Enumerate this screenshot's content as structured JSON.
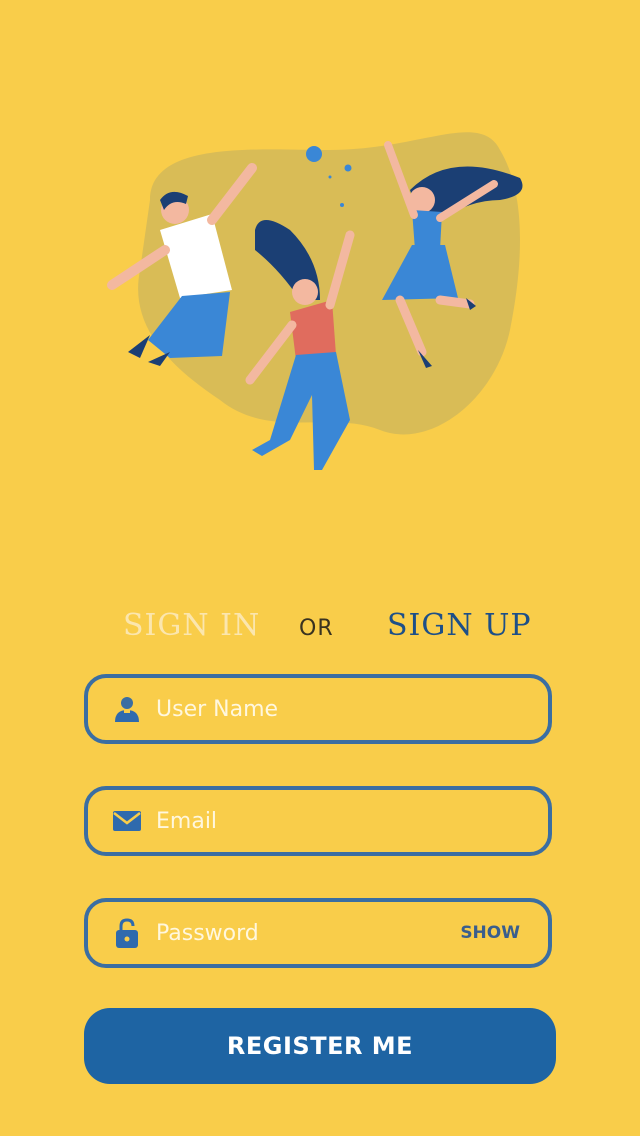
{
  "tabs": {
    "sign_in": "SIGN IN",
    "or": "OR",
    "sign_up": "SIGN UP"
  },
  "fields": [
    {
      "label": "User Name",
      "icon": "user-icon"
    },
    {
      "label": "Email",
      "icon": "envelope-icon"
    },
    {
      "label": "Password",
      "icon": "lock-icon",
      "action": "SHOW"
    }
  ],
  "button": {
    "label": "REGISTER ME"
  },
  "colors": {
    "background": "#F9CD4A",
    "accent": "#1E64A3",
    "field_border": "#3B6EA2",
    "blob": "#D9BC56"
  }
}
